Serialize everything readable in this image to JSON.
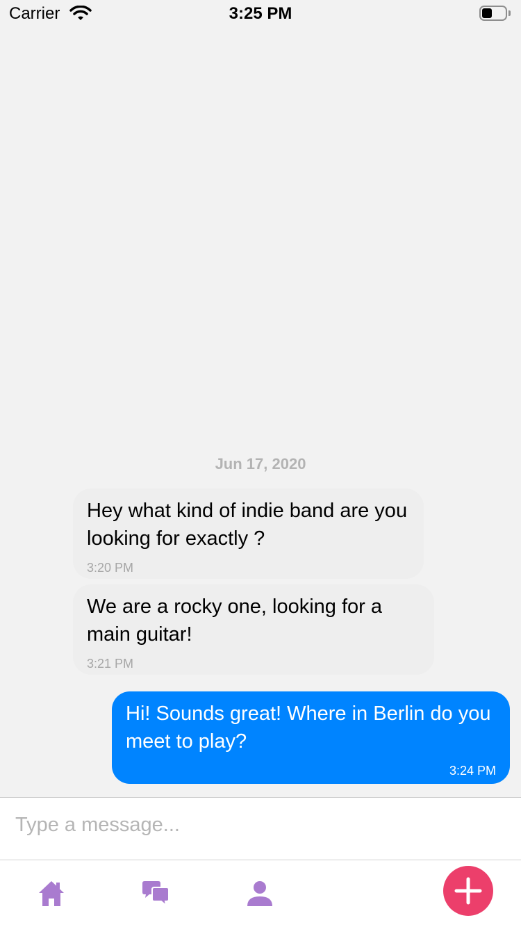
{
  "status_bar": {
    "carrier": "Carrier",
    "time": "3:25 PM",
    "battery_level": 0.45
  },
  "chat": {
    "date_separator": "Jun 17, 2020",
    "messages": [
      {
        "direction": "received",
        "text": "Hey what kind of indie band are you looking for exactly ?",
        "time": "3:20 PM"
      },
      {
        "direction": "received",
        "text": "We are a rocky one, looking for a main guitar!",
        "time": "3:21 PM"
      },
      {
        "direction": "sent",
        "text": "Hi! Sounds great! Where in Berlin do you meet to play?",
        "time": "3:24 PM"
      }
    ]
  },
  "composer": {
    "placeholder": "Type a message...",
    "value": ""
  },
  "tab_bar": {
    "icons": [
      "home-icon",
      "chat-bubbles-icon",
      "profile-icon",
      "plus-icon"
    ],
    "icon_color": "#a97bcf",
    "fab_color": "#ec3f6b"
  },
  "colors": {
    "sent_bubble": "#0084ff",
    "received_bubble": "#eeeeee",
    "background": "#f2f2f2"
  }
}
